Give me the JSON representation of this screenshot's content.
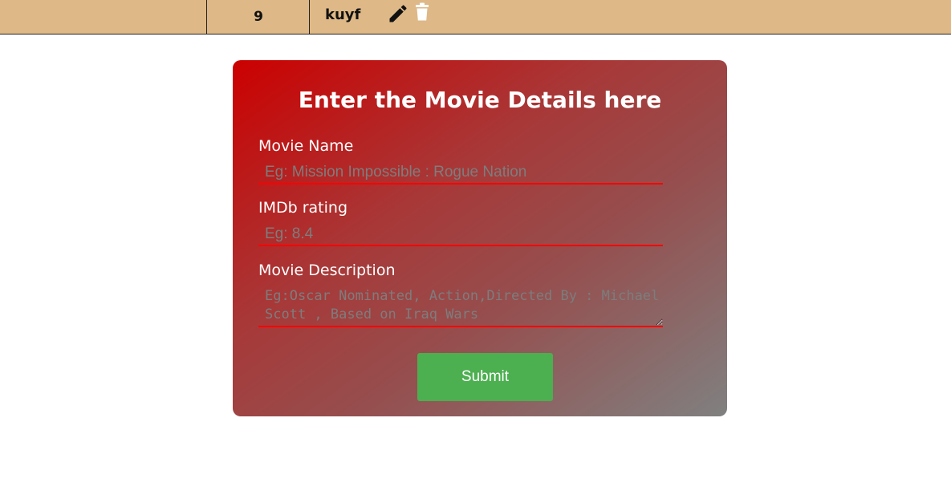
{
  "table_row": {
    "id": "9",
    "name": "kuyf",
    "edit_icon": "pencil-icon",
    "delete_icon": "trash-icon"
  },
  "form": {
    "title": "Enter the Movie Details here",
    "movie_name": {
      "label": "Movie Name",
      "placeholder": "Eg: Mission Impossible : Rogue Nation",
      "value": ""
    },
    "imdb_rating": {
      "label": "IMDb rating",
      "placeholder": "Eg: 8.4",
      "value": ""
    },
    "movie_description": {
      "label": "Movie Description",
      "placeholder": "Eg:Oscar Nominated, Action,Directed By : Michael Scott , Based on Iraq Wars",
      "value": ""
    },
    "submit_label": "Submit"
  },
  "colors": {
    "row_background": "#deb887",
    "card_gradient_start": "#cc0000",
    "card_gradient_end": "#808080",
    "input_underline": "#ff0000",
    "submit_background": "#4caf50"
  }
}
